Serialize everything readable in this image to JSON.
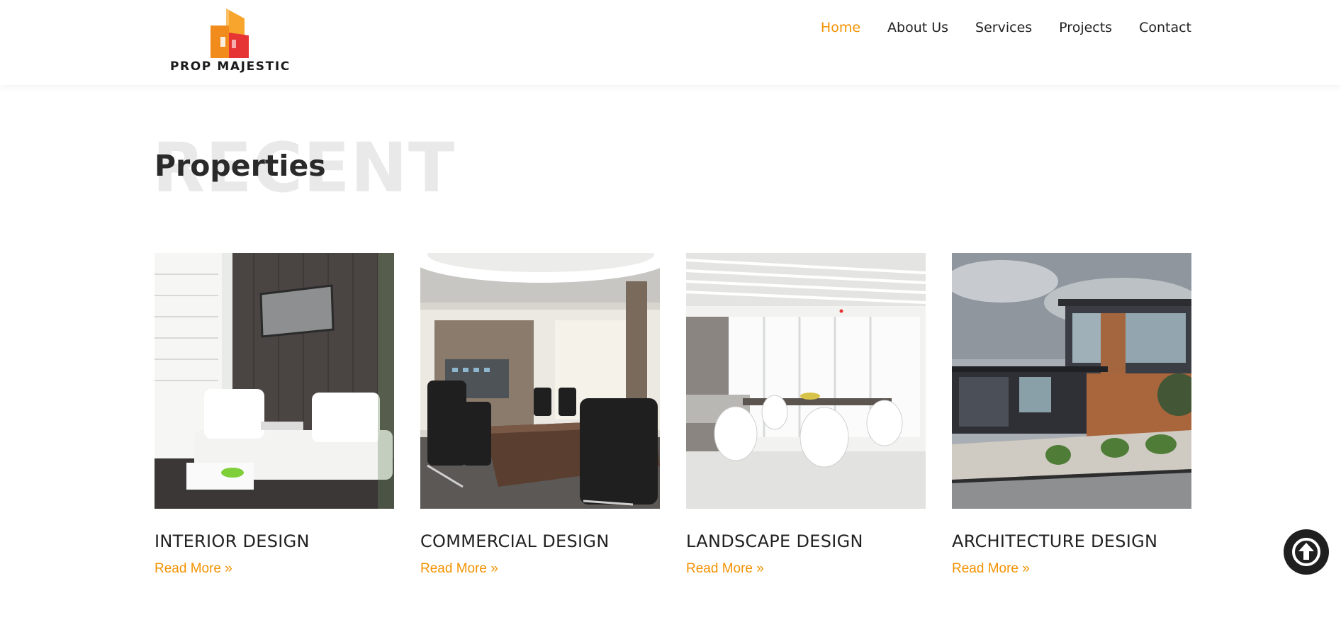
{
  "brand": {
    "name": "PROP MAJESTIC",
    "colors": {
      "orange": "#f7a52d",
      "dark_orange": "#f08b1c",
      "red": "#e63434"
    }
  },
  "nav": {
    "items": [
      {
        "label": "Home",
        "active": true
      },
      {
        "label": "About Us",
        "active": false
      },
      {
        "label": "Services",
        "active": false
      },
      {
        "label": "Projects",
        "active": false
      },
      {
        "label": "Contact",
        "active": false
      }
    ],
    "active_color": "#f39200"
  },
  "section": {
    "background_text": "RECENT",
    "title": "Properties"
  },
  "cards": [
    {
      "title": "INTERIOR DESIGN",
      "link": "Read More »",
      "image": "interior-living-room"
    },
    {
      "title": "COMMERCIAL DESIGN",
      "link": "Read More »",
      "image": "conference-room"
    },
    {
      "title": "LANDSCAPE DESIGN",
      "link": "Read More »",
      "image": "white-dining-room"
    },
    {
      "title": "ARCHITECTURE DESIGN",
      "link": "Read More »",
      "image": "modern-house-exterior"
    }
  ],
  "scroll_top": {
    "icon": "arrow-up-circle-icon"
  },
  "accent": "#f39200"
}
